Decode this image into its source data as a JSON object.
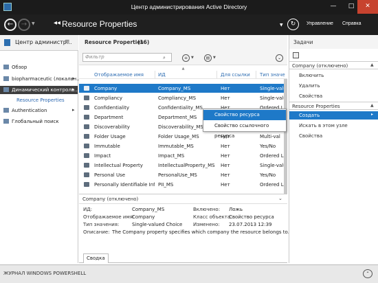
{
  "window": {
    "title": "Центр администрирования Active Directory",
    "min": "—",
    "max": "□",
    "close": "✕"
  },
  "header": {
    "title": "Resource Properties",
    "manage": "Управление",
    "help": "Справка"
  },
  "leftnav": {
    "title": "Центр администр...",
    "items": [
      {
        "label": "Обзор"
      },
      {
        "label": "biopharmaceutic (локальн..."
      },
      {
        "label": "Динамический контроль..."
      },
      {
        "label": "Resource Properties"
      },
      {
        "label": "Authentication"
      },
      {
        "label": "Глобальный поиск"
      }
    ]
  },
  "list": {
    "title": "Resource Properties",
    "count": "(16)",
    "filter_placeholder": "Фильтр",
    "columns": [
      "Отображаемое имя",
      "ИД",
      "Для ссылки",
      "Тип значе"
    ],
    "rows": [
      {
        "name": "Company",
        "id": "Company_MS",
        "ref": "Нет",
        "type": "Single-valu"
      },
      {
        "name": "Compliancy",
        "id": "Compliancy_MS",
        "ref": "Нет",
        "type": "Single-valu"
      },
      {
        "name": "Confidentiality",
        "id": "Confidentiality_MS",
        "ref": "Нет",
        "type": "Ordered Li"
      },
      {
        "name": "Department",
        "id": "Department_MS",
        "ref": "",
        "type": ""
      },
      {
        "name": "Discoverability",
        "id": "Discoverability_MS",
        "ref": "",
        "type": ""
      },
      {
        "name": "Folder Usage",
        "id": "Folder Usage_MS",
        "ref": "Нет",
        "type": "Multi-val"
      },
      {
        "name": "Immutable",
        "id": "Immutable_MS",
        "ref": "Нет",
        "type": "Yes/No"
      },
      {
        "name": "Impact",
        "id": "Impact_MS",
        "ref": "Нет",
        "type": "Ordered Li"
      },
      {
        "name": "Intellectual Property",
        "id": "IntellectualProperty_MS",
        "ref": "Нет",
        "type": "Single-valu"
      },
      {
        "name": "Personal Use",
        "id": "PersonalUse_MS",
        "ref": "Нет",
        "type": "Yes/No"
      },
      {
        "name": "Personally Identifiable Info...",
        "id": "PII_MS",
        "ref": "Нет",
        "type": "Ordered Li"
      }
    ]
  },
  "context_menu": {
    "item1": "Свойство ресурса",
    "item2": "Свойство ссылочного ресурса"
  },
  "details": {
    "title": "Company (отключено)",
    "id_label": "ИД:",
    "id_value": "Company_MS",
    "display_label": "Отображаемое имя:",
    "display_value": "Company",
    "valtype_label": "Тип значения:",
    "valtype_value": "Single-valued Choice",
    "enabled_label": "Включено:",
    "enabled_value": "Ложь",
    "class_label": "Класс объекта:",
    "class_value": "Свойство ресурса",
    "modified_label": "Изменено:",
    "modified_value": "23.07.2013 12:39",
    "desc_label": "Описание:",
    "desc_value": "The Company property specifies which company the resource belongs to.",
    "tab": "Сводка"
  },
  "tasks": {
    "title": "Задачи",
    "section1": "Company (отключено)",
    "items1": [
      "Включить",
      "Удалить",
      "Свойства"
    ],
    "section2": "Resource Properties",
    "items2": [
      "Создать",
      "Искать в этом узле",
      "Свойства"
    ]
  },
  "powershell": {
    "label": "ЖУРНАЛ WINDOWS POWERSHELL"
  }
}
